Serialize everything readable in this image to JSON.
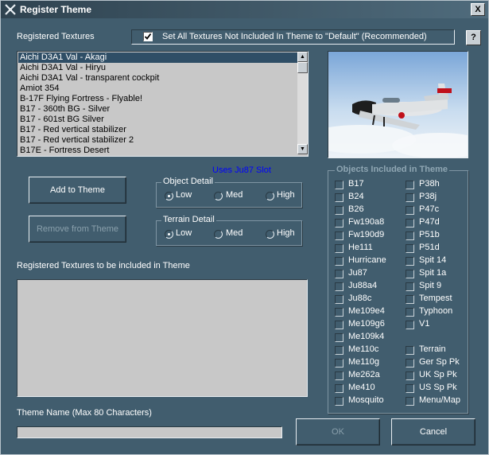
{
  "window": {
    "title": "Register Theme",
    "close_label": "X"
  },
  "labels": {
    "registered_textures": "Registered Textures",
    "set_all": "Set All Textures Not Included In Theme to \"Default\" (Recommended)",
    "help": "?",
    "slot": "Uses Ju87 Slot",
    "included_textures": "Registered Textures to be included in Theme",
    "theme_name": "Theme Name  (Max 80 Characters)"
  },
  "set_all_checked": true,
  "texture_list": [
    "Aichi D3A1 Val - Akagi",
    "Aichi D3A1 Val - Hiryu",
    "Aichi D3A1 Val - transparent cockpit",
    "Amiot 354",
    "B-17F Flying Fortress - Flyable!",
    "B17 - 360th BG - Silver",
    "B17 - 601st BG Silver",
    "B17 - Red vertical stabilizer",
    "B17 - Red vertical stabilizer 2",
    "B17E - Fortress Desert"
  ],
  "buttons": {
    "add": "Add to Theme",
    "remove": "Remove from Theme",
    "ok": "OK",
    "cancel": "Cancel"
  },
  "object_detail": {
    "title": "Object Detail",
    "options": [
      "Low",
      "Med",
      "High"
    ],
    "selected": "Low"
  },
  "terrain_detail": {
    "title": "Terrain Detail",
    "options": [
      "Low",
      "Med",
      "High"
    ],
    "selected": "Low"
  },
  "objects_group": {
    "title": "Objects Included in Theme",
    "col1": [
      "B17",
      "B24",
      "B26",
      "Fw190a8",
      "Fw190d9",
      "He111",
      "Hurricane",
      "Ju87",
      "Ju88a4",
      "Ju88c",
      "Me109e4",
      "Me109g6",
      "Me109k4",
      "Me110c",
      "Me110g",
      "Me262a",
      "Me410",
      "Mosquito"
    ],
    "col2": [
      "P38h",
      "P38j",
      "P47c",
      "P47d",
      "P51b",
      "P51d",
      "Spit 14",
      "Spit 1a",
      "Spit 9",
      "Tempest",
      "Typhoon",
      "V1",
      "",
      "Terrain",
      "Ger Sp Pk",
      "UK Sp Pk",
      "US Sp Pk",
      "Menu/Map"
    ]
  },
  "theme_name_value": "",
  "colors": {
    "window_bg": "#415d6e",
    "list_bg": "#c8c8c8",
    "selection": "#2f4e66",
    "slot_text": "#0000ff"
  }
}
